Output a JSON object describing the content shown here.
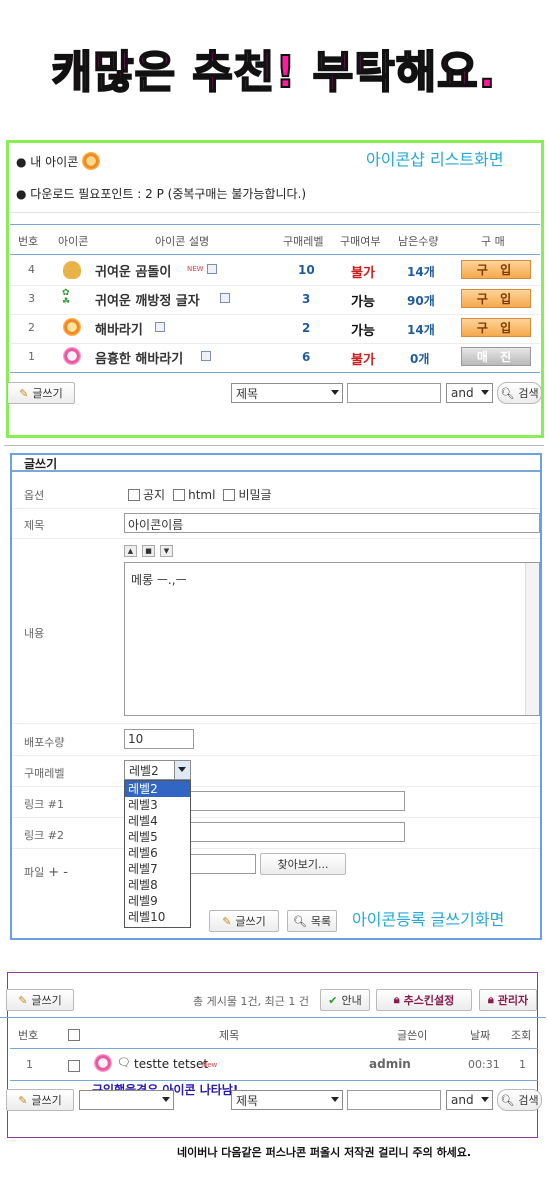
{
  "banner": "캐많은 추천! 부탁해요.",
  "list": {
    "my_icon_label": "● 내 아이콘",
    "points_label": "● 다운로드 필요포인트 : 2 P (중복구매는 불가능합니다.)",
    "caption": "아이콘샵 리스트화면",
    "headers": [
      "번호",
      "아이콘",
      "아이콘 설명",
      "구매레벨",
      "구매여부",
      "남은수량",
      "구 매"
    ],
    "rows": [
      {
        "no": "4",
        "desc": "귀여운 곰돌이",
        "new": "NEW",
        "level": "10",
        "avail": "불가",
        "qty": "14개",
        "action": "구 입"
      },
      {
        "no": "3",
        "desc": "귀여운 깨방정 글자",
        "new": "",
        "level": "3",
        "avail": "가능",
        "qty": "90개",
        "action": "구 입"
      },
      {
        "no": "2",
        "desc": "해바라기",
        "new": "",
        "level": "2",
        "avail": "가능",
        "qty": "14개",
        "action": "구 입"
      },
      {
        "no": "1",
        "desc": "음흉한 해바라기",
        "new": "",
        "level": "6",
        "avail": "불가",
        "qty": "0개",
        "action": "매 진"
      }
    ],
    "write_btn": "글쓰기",
    "search_field": "제목",
    "search_op": "and",
    "search_btn": "검색"
  },
  "form": {
    "heading": "글쓰기",
    "option_label": "옵션",
    "options": [
      "공지",
      "html",
      "비밀글"
    ],
    "subject_label": "제목",
    "subject_value": "아이콘이름",
    "content_label": "내용",
    "content_value": "메롱 ㅡ.,ㅡ",
    "qty_label": "배포수량",
    "qty_value": "10",
    "level_label": "구매레벨",
    "level_value": "레벨2",
    "level_options": [
      "레벨2",
      "레벨3",
      "레벨4",
      "레벨5",
      "레벨6",
      "레벨7",
      "레벨8",
      "레벨9",
      "레벨10"
    ],
    "link1_label": "링크 #1",
    "link2_label": "링크 #2",
    "file_label": "파일",
    "file_plusminus": "+ -",
    "browse_btn": "찾아보기...",
    "write_btn": "글쓰기",
    "list_btn": "목록",
    "caption": "아이콘등록 글쓰기화면"
  },
  "board": {
    "write_btn": "글쓰기",
    "summary": "총 게시물 1건, 최근 1 건",
    "guide_btn": "안내",
    "plugin_btn": "추스킨설정",
    "admin_btn": "관리자",
    "headers": [
      "번호",
      "제목",
      "글쓴이",
      "날짜",
      "조회"
    ],
    "row": {
      "no": "1",
      "title": "testte tetset",
      "new": "New",
      "author": "admin",
      "date": "00:31",
      "views": "1"
    },
    "note": "구입했을경우 아이콘 나타남!",
    "write_btn2": "글쓰기",
    "search_field": "제목",
    "search_op": "and",
    "search_btn": "검색"
  },
  "footer_note": "네이버나 다음같은 퍼스나콘 퍼올시 저작권 걸리니 주의 하세요."
}
